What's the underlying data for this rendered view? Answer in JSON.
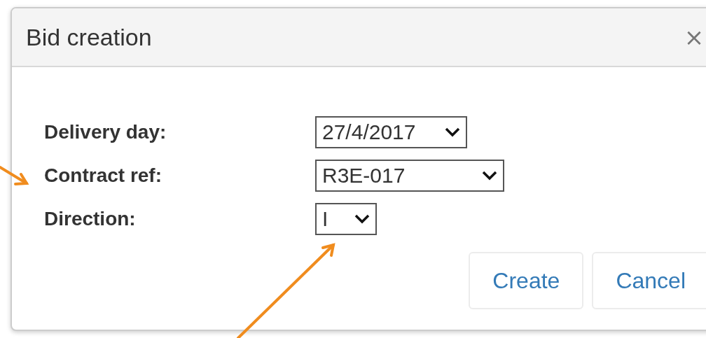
{
  "dialog": {
    "title": "Bid creation",
    "close": "×"
  },
  "fields": [
    {
      "label": "Delivery day:",
      "value": "27/4/2017"
    },
    {
      "label": "Contract ref:",
      "value": "R3E-017"
    },
    {
      "label": "Direction:",
      "value": "I"
    }
  ],
  "buttons": [
    "Create",
    "Cancel"
  ]
}
